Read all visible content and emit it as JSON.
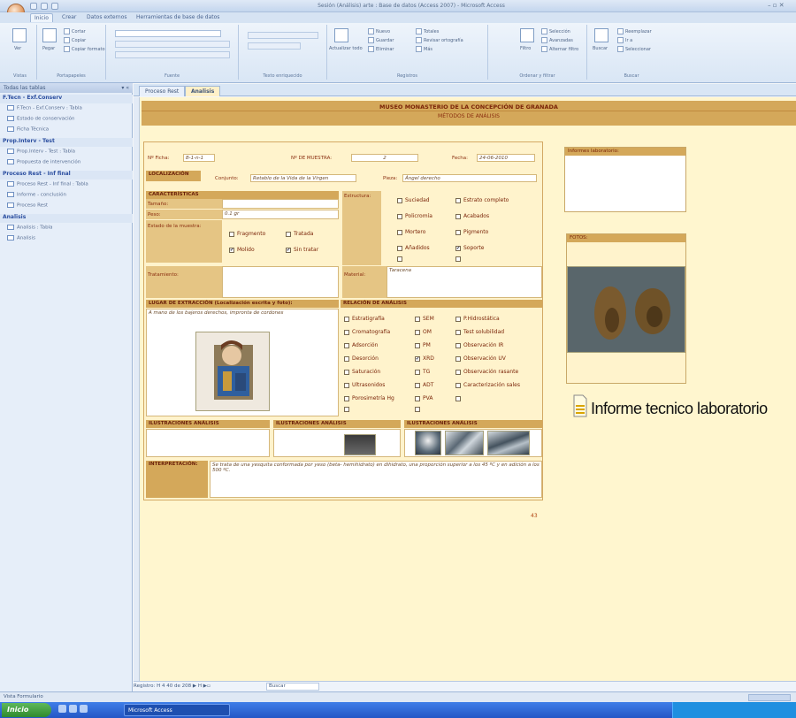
{
  "window": {
    "title": "Sesión (Análisis) arte : Base de datos (Access 2007) - Microsoft Access"
  },
  "ribbon": {
    "tabs": [
      "Inicio",
      "Crear",
      "Datos externos",
      "Herramientas de base de datos"
    ],
    "groups": [
      "Vistas",
      "Portapapeles",
      "Fuente",
      "Texto enriquecido",
      "Registros",
      "Ordenar y filtrar",
      "Buscar"
    ],
    "buttons": {
      "view": "Ver",
      "paste": "Pegar",
      "cut": "Cortar",
      "copy": "Copiar",
      "format_copy": "Copiar formato",
      "refresh": "Actualizar todo",
      "new": "Nuevo",
      "save": "Guardar",
      "delete": "Eliminar",
      "spelling": "Revisar ortografía",
      "totals": "Totales",
      "more": "Más",
      "filter": "Filtro",
      "selection": "Selección",
      "advanced": "Avanzadas",
      "toggle": "Alternar filtro",
      "find": "Buscar",
      "replace": "Reemplazar",
      "goto": "Ir a",
      "select": "Seleccionar"
    }
  },
  "nav": {
    "header": "Todas las tablas",
    "sections": [
      {
        "title": "F.Tecn - Exf.Conserv",
        "items": [
          "F.Tecn - Exf.Conserv : Tabla",
          "Estado de conservación",
          "Ficha Técnica"
        ]
      },
      {
        "title": "Prop.Interv - Test",
        "items": [
          "Prop.Interv - Test : Tabla",
          "Propuesta de intervención"
        ]
      },
      {
        "title": "Proceso Rest - Inf final",
        "items": [
          "Proceso Rest - Inf final : Tabla",
          "Informe - conclusión",
          "Proceso Rest"
        ]
      },
      {
        "title": "Analisis",
        "items": [
          "Analisis : Tabla",
          "Analisis"
        ]
      }
    ]
  },
  "doc_tabs": [
    "Proceso Rest",
    "Analisis"
  ],
  "form": {
    "title": "MUSEO MONASTERIO DE LA CONCEPCIÓN DE GRANADA",
    "subtitle": "MÉTODOS DE ANÁLISIS",
    "ficha_label": "Nº Ficha:",
    "ficha_value": "B-1-n-1",
    "muestra_label": "Nº DE MUESTRA:",
    "muestra_value": "2",
    "fecha_label": "Fecha:",
    "fecha_value": "24-06-2010",
    "localizacion": "LOCALIZACIÓN",
    "conjunto_label": "Conjunto:",
    "conjunto_value": "Retablo de la Vida de la Virgen",
    "pieza_label": "Pieza:",
    "pieza_value": "Ángel derecho",
    "caracteristicas": "CARACTERÍSTICAS",
    "tamano_label": "Tamaño:",
    "tamano_value": "",
    "peso_label": "Peso:",
    "peso_value": "0.1 gr",
    "estado_label": "Estado de la muestra:",
    "estado_opts": [
      {
        "label": "Fragmento",
        "checked": false
      },
      {
        "label": "Tratada",
        "checked": false
      },
      {
        "label": "Molido",
        "checked": true
      },
      {
        "label": "Sin tratar",
        "checked": true
      }
    ],
    "tratamiento_label": "Tratamiento:",
    "estructura_label": "Estructura:",
    "estructura_opts": [
      {
        "label": "Suciedad",
        "checked": false
      },
      {
        "label": "Estrato completo",
        "checked": false
      },
      {
        "label": "Policromía",
        "checked": false
      },
      {
        "label": "Acabados",
        "checked": false
      },
      {
        "label": "Mortero",
        "checked": false
      },
      {
        "label": "Pigmento",
        "checked": false
      },
      {
        "label": "Añadidos",
        "checked": false
      },
      {
        "label": "Soporte",
        "checked": true
      },
      {
        "label": "",
        "checked": false
      },
      {
        "label": "",
        "checked": false
      }
    ],
    "material_label": "Material:",
    "material_value": "Taracena",
    "lugar_header": "LUGAR DE EXTRACCIÓN (Localización escrita y foto):",
    "lugar_value": "A mano de los bajeros derechos, impronta de cordones",
    "relacion_header": "RELACIÓN DE ANÁLISIS",
    "analisis_col1": [
      {
        "label": "Estratigrafía",
        "checked": false
      },
      {
        "label": "Cromatografía",
        "checked": false
      },
      {
        "label": "Adsorción",
        "checked": false
      },
      {
        "label": "Desorción",
        "checked": false
      },
      {
        "label": "Saturación",
        "checked": false
      },
      {
        "label": "Ultrasonidos",
        "checked": false
      },
      {
        "label": "Porosimetría Hg",
        "checked": false
      },
      {
        "label": "",
        "checked": false
      }
    ],
    "analisis_col2": [
      {
        "label": "SEM",
        "checked": false
      },
      {
        "label": "OM",
        "checked": false
      },
      {
        "label": "PM",
        "checked": false
      },
      {
        "label": "XRD",
        "checked": true
      },
      {
        "label": "TG",
        "checked": false
      },
      {
        "label": "ADT",
        "checked": false
      },
      {
        "label": "PVA",
        "checked": false
      },
      {
        "label": "",
        "checked": false
      }
    ],
    "analisis_col3": [
      {
        "label": "P.Hidrostática",
        "checked": false
      },
      {
        "label": "Test solubilidad",
        "checked": false
      },
      {
        "label": "Observación IR",
        "checked": false
      },
      {
        "label": "Observación UV",
        "checked": false
      },
      {
        "label": "Observación rasante",
        "checked": false
      },
      {
        "label": "Caracterización sales",
        "checked": false
      },
      {
        "label": "",
        "checked": false
      }
    ],
    "ilus1": "ILUSTRACIONES ANÁLISIS",
    "ilus2": "ILUSTRACIONES ANÁLISIS",
    "ilus3": "ILUSTRACIONES ANÁLISIS",
    "interpretacion_label": "INTERPRETACIÓN:",
    "interpretacion_value": "Se trata de una yesquita conformada por yeso (beta- hemihidrato) en dihidrato, una proporción superior a los 45 ºC y en adición a los 500 ºC.",
    "page_number": "43",
    "observaciones_label": "Informes laboratorio:",
    "fotos_label": "FOTOS:",
    "report_link": "Informe tecnico laboratorio"
  },
  "navigation": {
    "text": "Registro: H  4  40 de 208  ▶  H  ▶▫",
    "search": "Buscar"
  },
  "status": {
    "text": "Vista Formulario"
  },
  "taskbar": {
    "start": "Inicio",
    "app": "Microsoft Access"
  },
  "colors": {
    "form_bg": "#fff6cf",
    "header_band": "#d4a85a",
    "label_red": "#8a2e10",
    "ribbon": "#d9e6f5"
  }
}
